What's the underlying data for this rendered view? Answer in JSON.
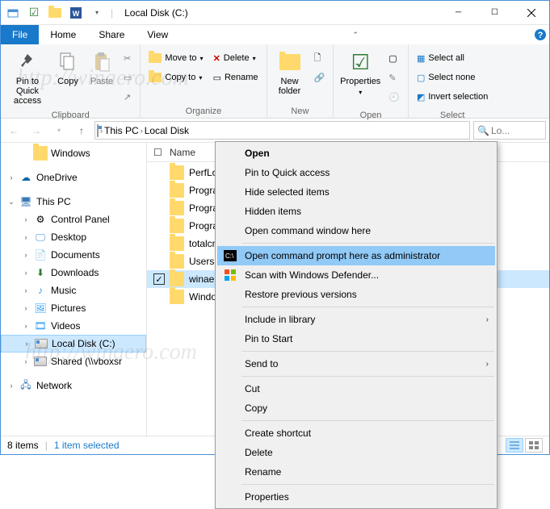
{
  "title": "Local Disk (C:)",
  "tabs": {
    "file": "File",
    "home": "Home",
    "share": "Share",
    "view": "View"
  },
  "ribbon": {
    "clipboard": {
      "label": "Clipboard",
      "pin": {
        "l1": "Pin to Quick",
        "l2": "access"
      },
      "copy": "Copy",
      "paste": "Paste"
    },
    "organize": {
      "label": "Organize",
      "moveto": "Move to",
      "copyto": "Copy to",
      "delete": "Delete",
      "rename": "Rename"
    },
    "new": {
      "label": "New",
      "newfolder": {
        "l1": "New",
        "l2": "folder"
      }
    },
    "open": {
      "label": "Open",
      "properties": "Properties"
    },
    "select": {
      "label": "Select",
      "all": "Select all",
      "none": "Select none",
      "invert": "Invert selection"
    }
  },
  "breadcrumb": {
    "pc": "This PC",
    "disk": "Local Disk"
  },
  "search_placeholder": "Lo...",
  "tree": {
    "windows": "Windows",
    "onedrive": "OneDrive",
    "thispc": "This PC",
    "cp": "Control Panel",
    "desktop": "Desktop",
    "documents": "Documents",
    "downloads": "Downloads",
    "music": "Music",
    "pictures": "Pictures",
    "videos": "Videos",
    "localdisk": "Local Disk (C:)",
    "shared": "Shared (\\\\vboxsr",
    "network": "Network"
  },
  "list": {
    "header_name": "Name",
    "items": [
      {
        "name": "PerfLogs"
      },
      {
        "name": "Program"
      },
      {
        "name": "Program"
      },
      {
        "name": "Program"
      },
      {
        "name": "totalcmd"
      },
      {
        "name": "Users"
      },
      {
        "name": "winaero",
        "selected": true
      },
      {
        "name": "Window"
      }
    ]
  },
  "ctx": {
    "open": "Open",
    "pin_qa": "Pin to Quick access",
    "hide_sel": "Hide selected items",
    "hidden": "Hidden items",
    "cmd_here": "Open command window here",
    "cmd_admin": "Open command prompt here as administrator",
    "defender": "Scan with Windows Defender...",
    "restore": "Restore previous versions",
    "include_lib": "Include in library",
    "pin_start": "Pin to Start",
    "sendto": "Send to",
    "cut": "Cut",
    "copy": "Copy",
    "shortcut": "Create shortcut",
    "delete": "Delete",
    "rename": "Rename",
    "properties": "Properties"
  },
  "status": {
    "count": "8 items",
    "selected": "1 item selected"
  },
  "watermark": "http://winaero.com"
}
